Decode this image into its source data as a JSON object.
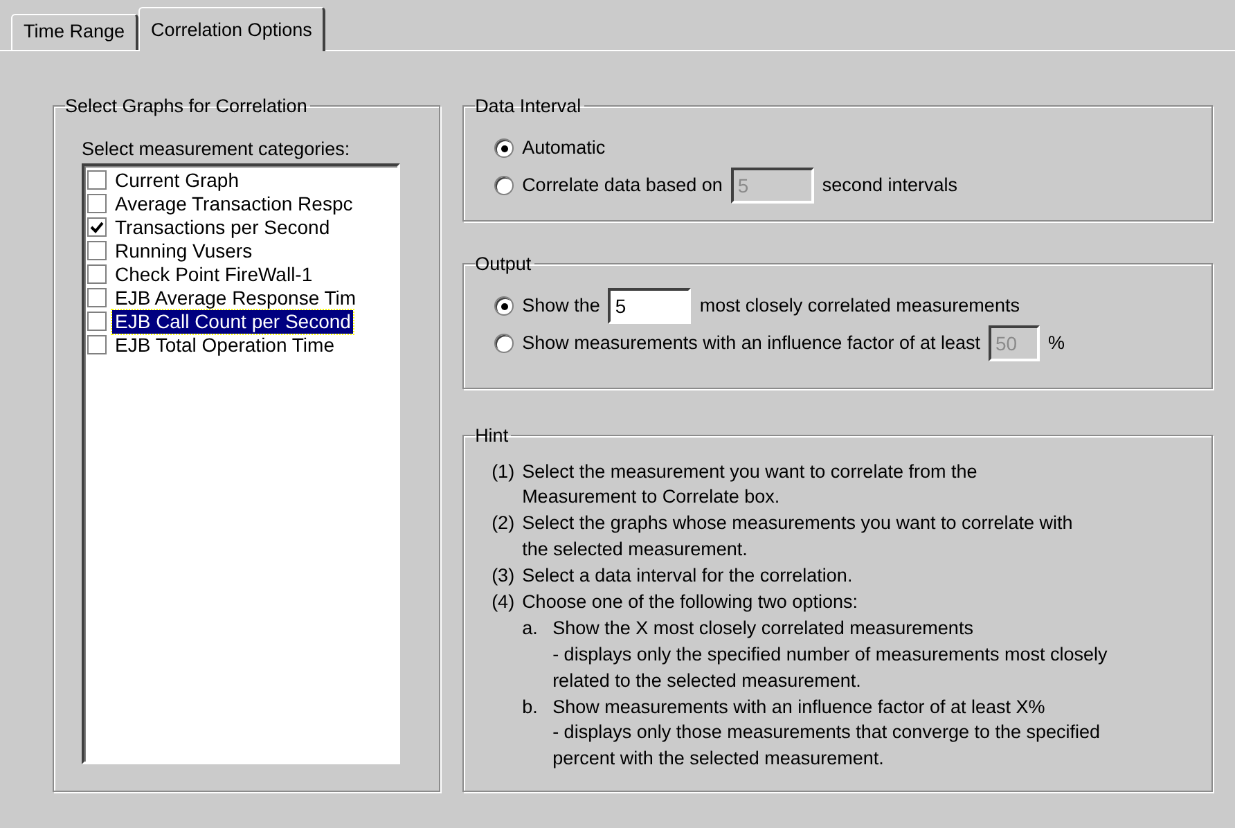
{
  "tabs": [
    {
      "label": "Time Range",
      "selected": false
    },
    {
      "label": "Correlation Options",
      "selected": true
    }
  ],
  "graphs_group": {
    "title": "Select Graphs for Correlation",
    "list_label": "Select measurement categories:",
    "items": [
      {
        "label": "Current Graph",
        "checked": false,
        "selected": false
      },
      {
        "label": "Average Transaction Respc",
        "checked": false,
        "selected": false
      },
      {
        "label": "Transactions per Second",
        "checked": true,
        "selected": false
      },
      {
        "label": "Running Vusers",
        "checked": false,
        "selected": false
      },
      {
        "label": "Check Point FireWall-1",
        "checked": false,
        "selected": false
      },
      {
        "label": "EJB Average Response Tim",
        "checked": false,
        "selected": false
      },
      {
        "label": "EJB Call Count per Second",
        "checked": false,
        "selected": true
      },
      {
        "label": "EJB Total Operation Time",
        "checked": false,
        "selected": false
      }
    ]
  },
  "data_interval": {
    "title": "Data Interval",
    "options": [
      {
        "kind": "radio",
        "selected": true,
        "label": "Automatic"
      },
      {
        "kind": "radio-field",
        "selected": false,
        "label_before": "Correlate data based on",
        "field": {
          "value": "5",
          "disabled": true
        },
        "label_after": "second intervals"
      }
    ]
  },
  "output": {
    "title": "Output",
    "options": [
      {
        "kind": "radio-field",
        "selected": true,
        "label_before": "Show the",
        "field": {
          "value": "5",
          "disabled": false
        },
        "label_after": "most closely correlated measurements"
      },
      {
        "kind": "radio-field",
        "selected": false,
        "label_before": "Show measurements with an influence factor of at least",
        "field": {
          "value": "50",
          "disabled": true
        },
        "label_after": "%"
      }
    ]
  },
  "hint": {
    "title": "Hint",
    "items": [
      {
        "number": "(1)",
        "text": "Select the measurement you want to correlate from the\nMeasurement to Correlate box."
      },
      {
        "number": "(2)",
        "text": "Select the graphs whose measurements you want to correlate with\nthe selected measurement."
      },
      {
        "number": "(3)",
        "text": "Select a data interval for the correlation."
      },
      {
        "number": "(4)",
        "text": "Choose one of the following two options:",
        "children": [
          {
            "number": "a.",
            "text": "Show the X most closely correlated measurements",
            "children": [
              {
                "text": "- displays only the specified number of measurements most closely\nrelated to the selected measurement."
              }
            ]
          },
          {
            "number": "b.",
            "text": "Show measurements with an influence factor of at least X%",
            "children": [
              {
                "text": "- displays only those measurements that converge to the specified\npercent with the selected measurement."
              }
            ]
          }
        ]
      }
    ]
  }
}
